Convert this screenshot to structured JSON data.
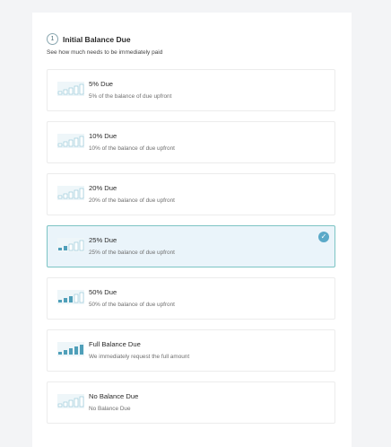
{
  "section": {
    "step_number": "1",
    "title": "Initial Balance Due",
    "subtitle": "See how much needs to be immediately paid"
  },
  "colors": {
    "accent": "#5aa9c8",
    "bar_filled": "#4f9fb9",
    "bar_empty_stroke": "#8ec3d6",
    "selected_bg": "#eaf4fa",
    "selected_border": "#7cc4c4"
  },
  "options": [
    {
      "label": "5% Due",
      "description": "5% of the balance of due upfront",
      "filled_bars": 0,
      "selected": false
    },
    {
      "label": "10% Due",
      "description": "10% of the balance of due upfront",
      "filled_bars": 0,
      "selected": false
    },
    {
      "label": "20% Due",
      "description": "20% of the balance of due upfront",
      "filled_bars": 0,
      "selected": false
    },
    {
      "label": "25% Due",
      "description": "25% of the balance of due upfront",
      "filled_bars": 2,
      "selected": true
    },
    {
      "label": "50% Due",
      "description": "50% of the balance of due upfront",
      "filled_bars": 3,
      "selected": false
    },
    {
      "label": "Full Balance Due",
      "description": "We immediately request the full amount",
      "filled_bars": 5,
      "selected": false
    },
    {
      "label": "No Balance Due",
      "description": "No Balance Due",
      "filled_bars": 0,
      "selected": false
    }
  ],
  "icons": {
    "option": "signal-bars-icon",
    "selected": "checkmark-icon",
    "step": "step-number-icon"
  }
}
